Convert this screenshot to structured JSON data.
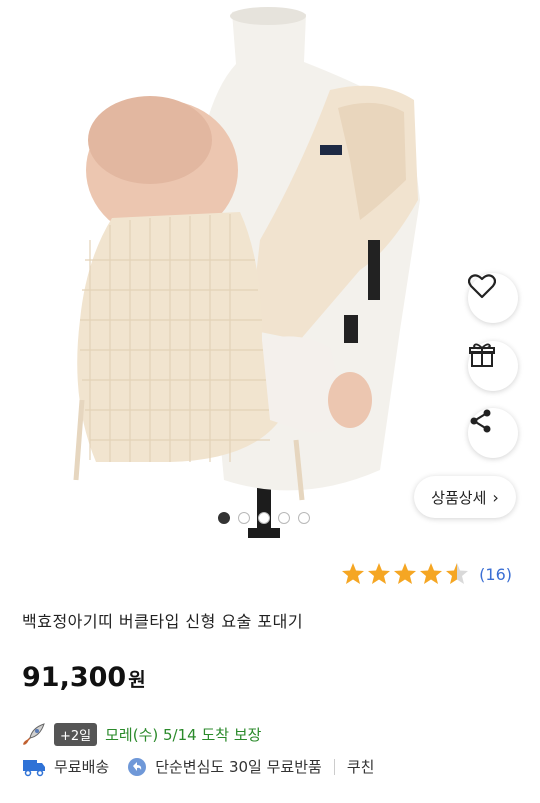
{
  "product": {
    "detail_button_label": "상품상세",
    "rating_count": "(16)",
    "rating_value": 4.5,
    "title": "백효정아기띠 버클타입 신형 요술 포대기",
    "price": "91,300",
    "price_unit": "원"
  },
  "delivery": {
    "badge": "+2일",
    "arrival_text": "모레(수) 5/14 도착 보장"
  },
  "benefits": {
    "free_shipping": "무료배송",
    "free_return": "단순변심도 30일 무료반품",
    "coupon": "쿠친"
  },
  "carousel": {
    "total": 5,
    "current": 1
  },
  "colors": {
    "star": "#f5a623",
    "rating_count": "#3b6fd4",
    "arrival": "#2b8a2b",
    "shipping_truck": "#2f72d6"
  }
}
